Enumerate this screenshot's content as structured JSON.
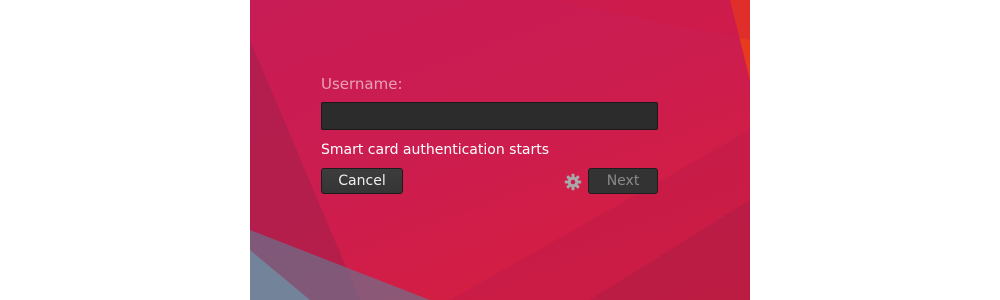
{
  "login": {
    "username_label": "Username:",
    "username_value": "",
    "status_message": "Smart card authentication starts",
    "cancel_label": "Cancel",
    "next_label": "Next",
    "settings_icon": "gear-icon"
  },
  "colors": {
    "background_accent": "#cc1d4f",
    "input_background": "#2c2c2c",
    "label_color": "#e8a0b6",
    "button_background": "#353535"
  }
}
